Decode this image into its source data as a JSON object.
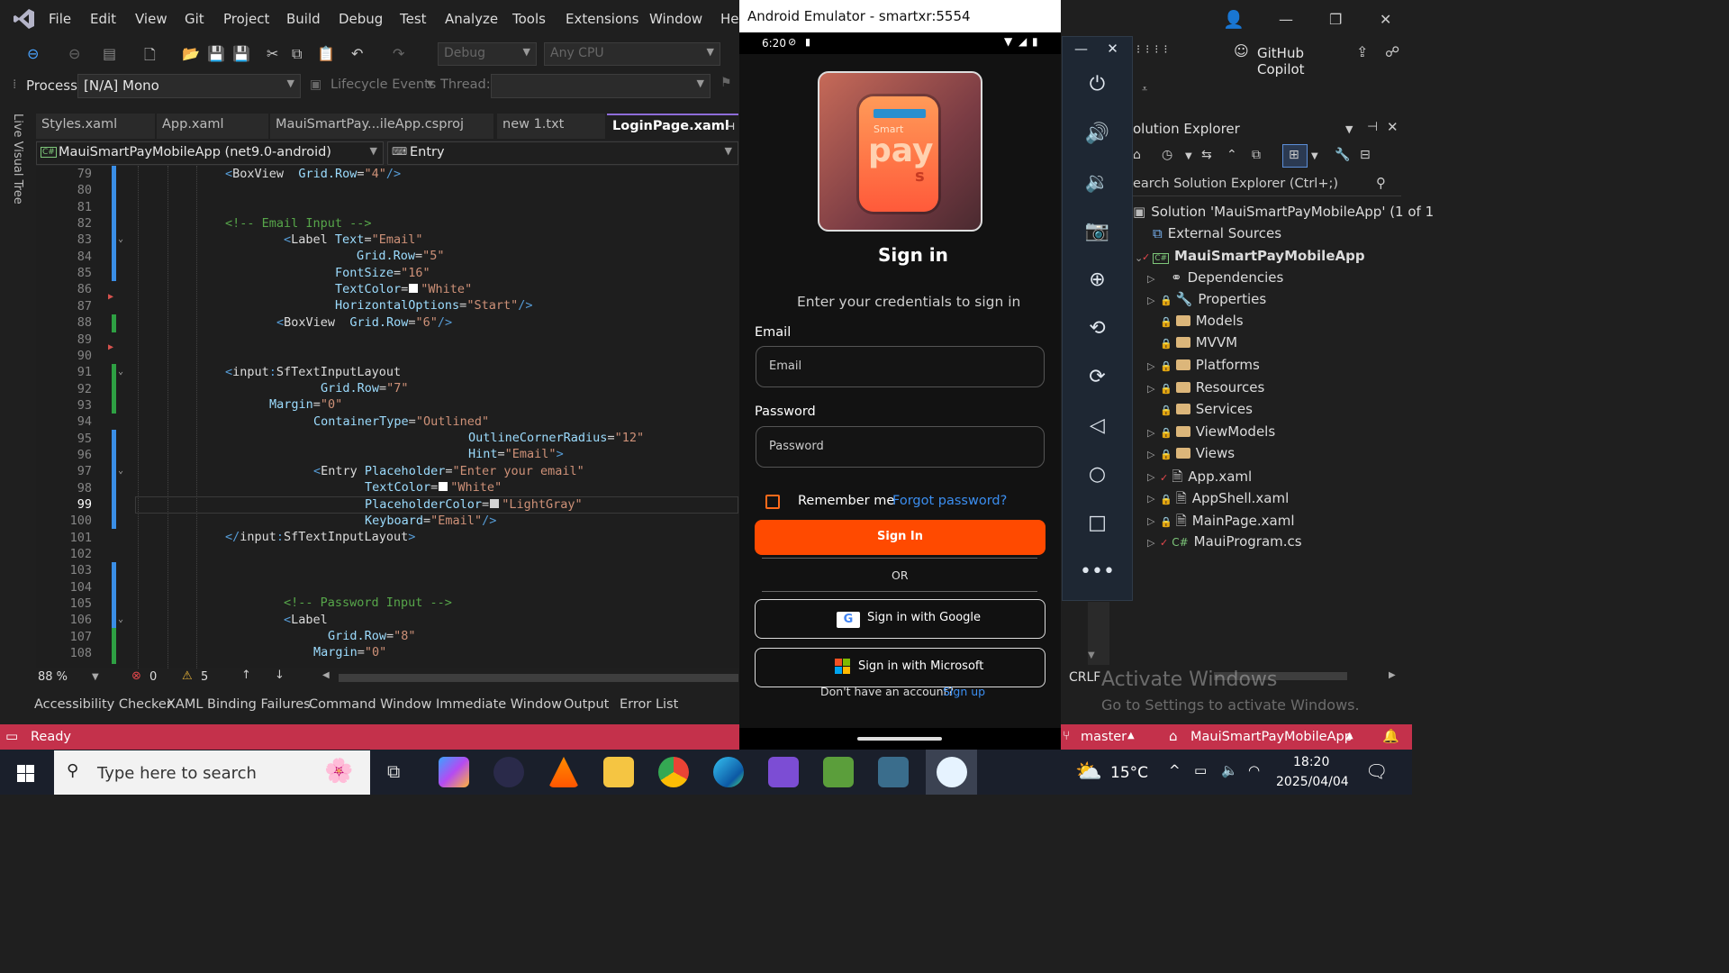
{
  "menu": [
    "File",
    "Edit",
    "View",
    "Git",
    "Project",
    "Build",
    "Debug",
    "Test",
    "Analyze",
    "Tools",
    "Extensions",
    "Window",
    "He"
  ],
  "toolbar": {
    "config": "Debug",
    "platform": "Any CPU",
    "process_label": "Process:",
    "process_value": "[N/A] Mono",
    "lifecycle": "Lifecycle Events",
    "thread_label": "Thread:",
    "copilot": "GitHub Copilot"
  },
  "side_panel": "Live Visual Tree",
  "tabs": [
    "Styles.xaml",
    "App.xaml",
    "MauiSmartPay...ileApp.csproj",
    "new 1.txt",
    "LoginPage.xaml"
  ],
  "nav": {
    "project": "MauiSmartPayMobileApp (net9.0-android)",
    "member": "Entry"
  },
  "code": {
    "line_numbers": [
      "79",
      "80",
      "81",
      "82",
      "83",
      "84",
      "85",
      "86",
      "87",
      "88",
      "89",
      "90",
      "91",
      "92",
      "93",
      "94",
      "95",
      "96",
      "97",
      "98",
      "99",
      "100",
      "101",
      "102",
      "103",
      "104",
      "105",
      "106",
      "107",
      "108"
    ],
    "current_line": "99"
  },
  "status_line": {
    "zoom": "88 %",
    "errors": "0",
    "warnings": "5",
    "eol": "CRLF"
  },
  "bottom_tabs": [
    "Accessibility Checker",
    "XAML Binding Failures",
    "Command Window",
    "Immediate Window",
    "Output",
    "Error List"
  ],
  "statusbar": {
    "ready": "Ready",
    "branch": "master",
    "project": "MauiSmartPayMobileApp"
  },
  "activate": {
    "title": "Activate Windows",
    "sub": "Go to Settings to activate Windows."
  },
  "emulator": {
    "title": "Android Emulator - smartxr:5554",
    "time": "6:20",
    "logo_text_top": "Smart",
    "logo_text_main": "pay",
    "logo_text_s": "s",
    "heading": "Sign in",
    "subheading": "Enter your credentials to sign in",
    "email_label": "Email",
    "email_placeholder": "Email",
    "password_label": "Password",
    "password_placeholder": "Password",
    "remember": "Remember me",
    "forgot": "Forgot password?",
    "signin_button": "Sign In",
    "or": "OR",
    "google": "Sign in with Google",
    "microsoft": "Sign in with Microsoft",
    "no_account": "Don't have an account?",
    "signup": "Sign up",
    "accent": "#ff4a00",
    "link": "#3b8ef0"
  },
  "solution": {
    "title": "olution Explorer",
    "search": "earch Solution Explorer (Ctrl+;)",
    "root": "Solution 'MauiSmartPayMobileApp' (1 of 1",
    "items": [
      "External Sources",
      "MauiSmartPayMobileApp",
      "Dependencies",
      "Properties",
      "Models",
      "MVVM",
      "Platforms",
      "Resources",
      "Services",
      "ViewModels",
      "Views",
      "App.xaml",
      "AppShell.xaml",
      "MainPage.xaml",
      "MauiProgram.cs"
    ]
  },
  "taskbar": {
    "search": "Type here to search",
    "temp": "15°C",
    "time": "18:20",
    "date": "2025/04/04"
  }
}
